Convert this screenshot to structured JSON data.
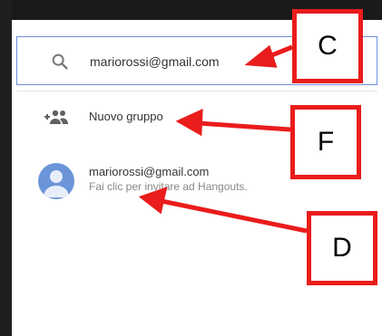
{
  "search": {
    "value": "mariorossi@gmail.com"
  },
  "menu": {
    "new_group_label": "Nuovo gruppo"
  },
  "contact": {
    "email": "mariorossi@gmail.com",
    "subtitle": "Fai clic per invitare ad Hangouts."
  },
  "callouts": {
    "c": "C",
    "f": "F",
    "d": "D"
  },
  "colors": {
    "callout_red": "#ea1c1c",
    "focus_blue": "#6d8fe0",
    "avatar_blue": "#6b95d8"
  },
  "icons": [
    "search-icon",
    "add-group-icon",
    "avatar-icon"
  ]
}
